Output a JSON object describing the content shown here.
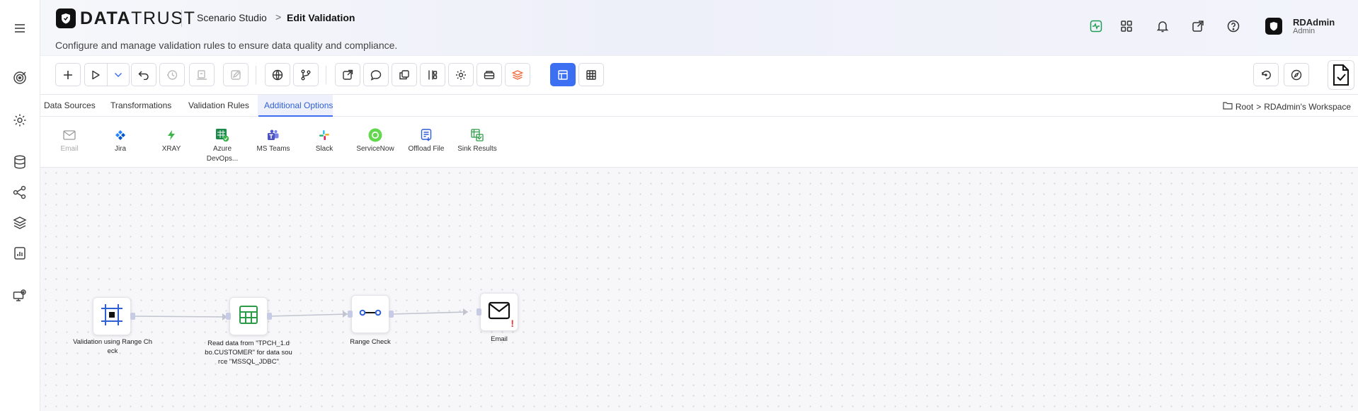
{
  "app": {
    "logo_bold": "DATA",
    "logo_light": "TRUST",
    "breadcrumb_root": "Scenario Studio",
    "breadcrumb_sep": ">",
    "breadcrumb_current": "Edit Validation",
    "subtitle": "Configure and manage validation rules to ensure data quality and compliance."
  },
  "user": {
    "name": "RDAdmin",
    "role": "Admin"
  },
  "tabs": [
    {
      "label": "Data Sources",
      "active": false
    },
    {
      "label": "Transformations",
      "active": false
    },
    {
      "label": "Validation Rules",
      "active": false
    },
    {
      "label": "Additional Options",
      "active": true
    }
  ],
  "workspace": {
    "root": "Root",
    "sep": ">",
    "name": "RDAdmin's Workspace"
  },
  "integrations": [
    {
      "label": "Email",
      "icon": "mail-icon",
      "enabled": false
    },
    {
      "label": "Jira",
      "icon": "jira-icon",
      "enabled": true
    },
    {
      "label": "XRAY",
      "icon": "xray-icon",
      "enabled": true
    },
    {
      "label": "Azure DevOps...",
      "label_line1": "Azure",
      "label_line2": "DevOps...",
      "icon": "azure-devops-icon",
      "enabled": true
    },
    {
      "label": "MS Teams",
      "icon": "ms-teams-icon",
      "enabled": true
    },
    {
      "label": "Slack",
      "icon": "slack-icon",
      "enabled": true
    },
    {
      "label": "ServiceNow",
      "icon": "servicenow-icon",
      "enabled": true
    },
    {
      "label": "Offload File",
      "icon": "offload-file-icon",
      "enabled": true
    },
    {
      "label": "Sink Results",
      "icon": "sink-results-icon",
      "enabled": true
    }
  ],
  "flow": {
    "nodes": [
      {
        "label_line1": "Validation using Range Ch",
        "label_line2": "eck",
        "icon": "validation-icon"
      },
      {
        "label_line1": "Read data from \"TPCH_1.d",
        "label_line2": "bo.CUSTOMER\" for data sou",
        "label_line3": "rce \"MSSQL_JDBC\"",
        "icon": "table-icon"
      },
      {
        "label_line1": "Range Check",
        "icon": "range-check-icon"
      },
      {
        "label_line1": "Email",
        "icon": "mail-icon",
        "warning": "!"
      }
    ]
  },
  "colors": {
    "accent": "#3d6ff2",
    "warning": "#e53935",
    "canvas_bg": "#f7f7f9"
  }
}
